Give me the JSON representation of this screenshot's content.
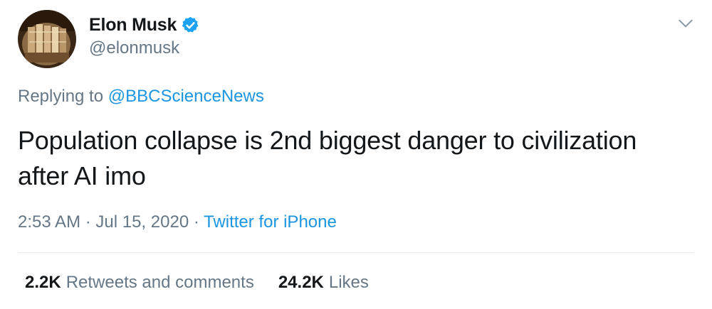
{
  "author": {
    "display_name": "Elon Musk",
    "handle": "@elonmusk",
    "verified": true
  },
  "reply": {
    "prefix": "Replying to",
    "mention": "@BBCScienceNews"
  },
  "tweet": {
    "text": "Population collapse is 2nd biggest danger to civilization after AI imo"
  },
  "meta": {
    "time": "2:53 AM",
    "separator": " · ",
    "date": "Jul 15, 2020",
    "source": "Twitter for iPhone"
  },
  "stats": {
    "retweets_count": "2.2K",
    "retweets_label": "Retweets and comments",
    "likes_count": "24.2K",
    "likes_label": "Likes"
  },
  "colors": {
    "text": "#14171a",
    "secondary": "#657786",
    "link": "#1b95e0",
    "verified": "#1da1f2",
    "divider": "#e6ecf0"
  },
  "icons": {
    "verified": "verified-badge-icon",
    "menu": "chevron-down-icon"
  }
}
